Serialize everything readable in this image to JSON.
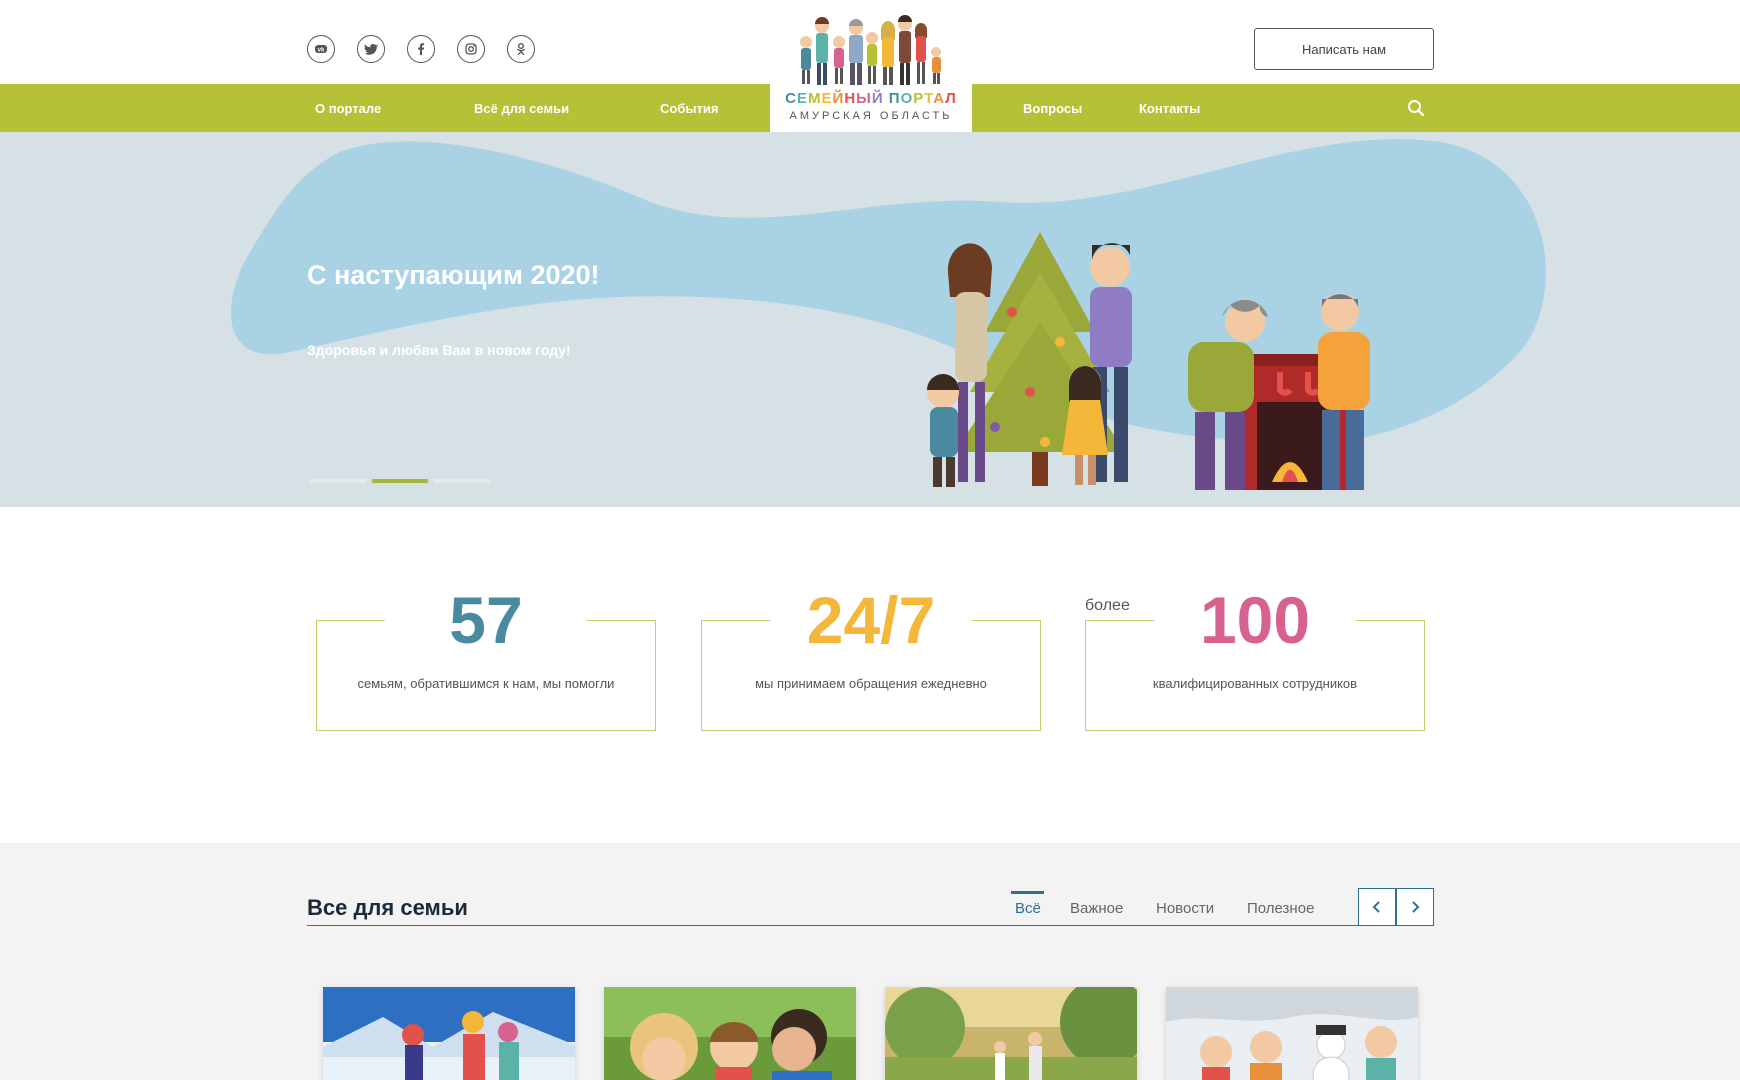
{
  "header": {
    "socials": [
      {
        "name": "vk-icon"
      },
      {
        "name": "twitter-icon"
      },
      {
        "name": "facebook-icon"
      },
      {
        "name": "instagram-icon"
      },
      {
        "name": "odnoklassniki-icon"
      }
    ],
    "write_button": "Написать нам"
  },
  "logo": {
    "title": "СЕМЕЙНЫЙ ПОРТАЛ",
    "subtitle": "АМУРСКАЯ ОБЛАСТЬ"
  },
  "nav": {
    "items": [
      "О портале",
      "Всё для семьи",
      "События",
      "Вопросы",
      "Контакты"
    ],
    "search_icon": "search-icon"
  },
  "hero": {
    "title": "С наступающим 2020!",
    "subtitle": "Здоровья и любви Вам в новом году!",
    "slides_total": 3,
    "active_slide": 2
  },
  "stats": [
    {
      "prefix": "",
      "number": "57",
      "label": "семьям, обратившимся к нам, мы помогли",
      "color": "#4a8aa0"
    },
    {
      "prefix": "",
      "number": "24/7",
      "label": "мы принимаем обращения ежедневно",
      "color": "#f4b73a"
    },
    {
      "prefix": "более",
      "number": "100",
      "label": "квалифицированных сотрудников",
      "color": "#d7628f"
    }
  ],
  "family": {
    "title": "Все для семьи",
    "tabs": [
      "Всё",
      "Важное",
      "Новости",
      "Полезное"
    ],
    "active_tab": "Всё"
  },
  "colors": {
    "nav_green": "#b5c136",
    "accent_blue": "#2f6f8f",
    "hero_bg": "#d6e1e5",
    "hero_blob": "#a9d2e5"
  }
}
